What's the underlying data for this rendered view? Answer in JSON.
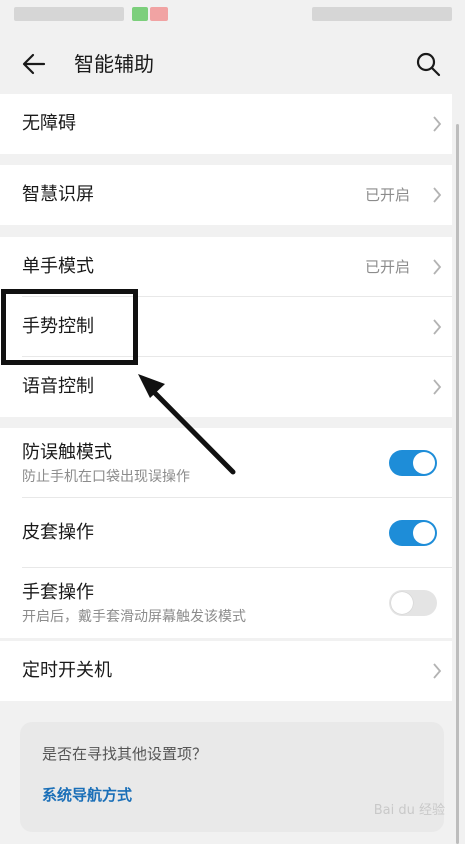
{
  "header": {
    "title": "智能辅助"
  },
  "menu": {
    "accessibility": {
      "label": "无障碍"
    },
    "smart_screen": {
      "label": "智慧识屏",
      "value": "已开启"
    },
    "one_hand": {
      "label": "单手模式",
      "value": "已开启"
    },
    "gesture": {
      "label": "手势控制"
    },
    "voice": {
      "label": "语音控制"
    },
    "anti_mistouch": {
      "label": "防误触模式",
      "sublabel": "防止手机在口袋出现误操作",
      "enabled": true
    },
    "cover": {
      "label": "皮套操作",
      "enabled": true
    },
    "glove": {
      "label": "手套操作",
      "sublabel": "开启后，戴手套滑动屏幕触发该模式",
      "enabled": false
    },
    "schedule": {
      "label": "定时开关机"
    }
  },
  "suggestion": {
    "question": "是否在寻找其他设置项？",
    "link": "系统导航方式"
  },
  "watermark": "Bai du 经验",
  "colors": {
    "accent": "#1e8dd8",
    "link": "#1a6fb8",
    "background": "#f1f1f1"
  }
}
